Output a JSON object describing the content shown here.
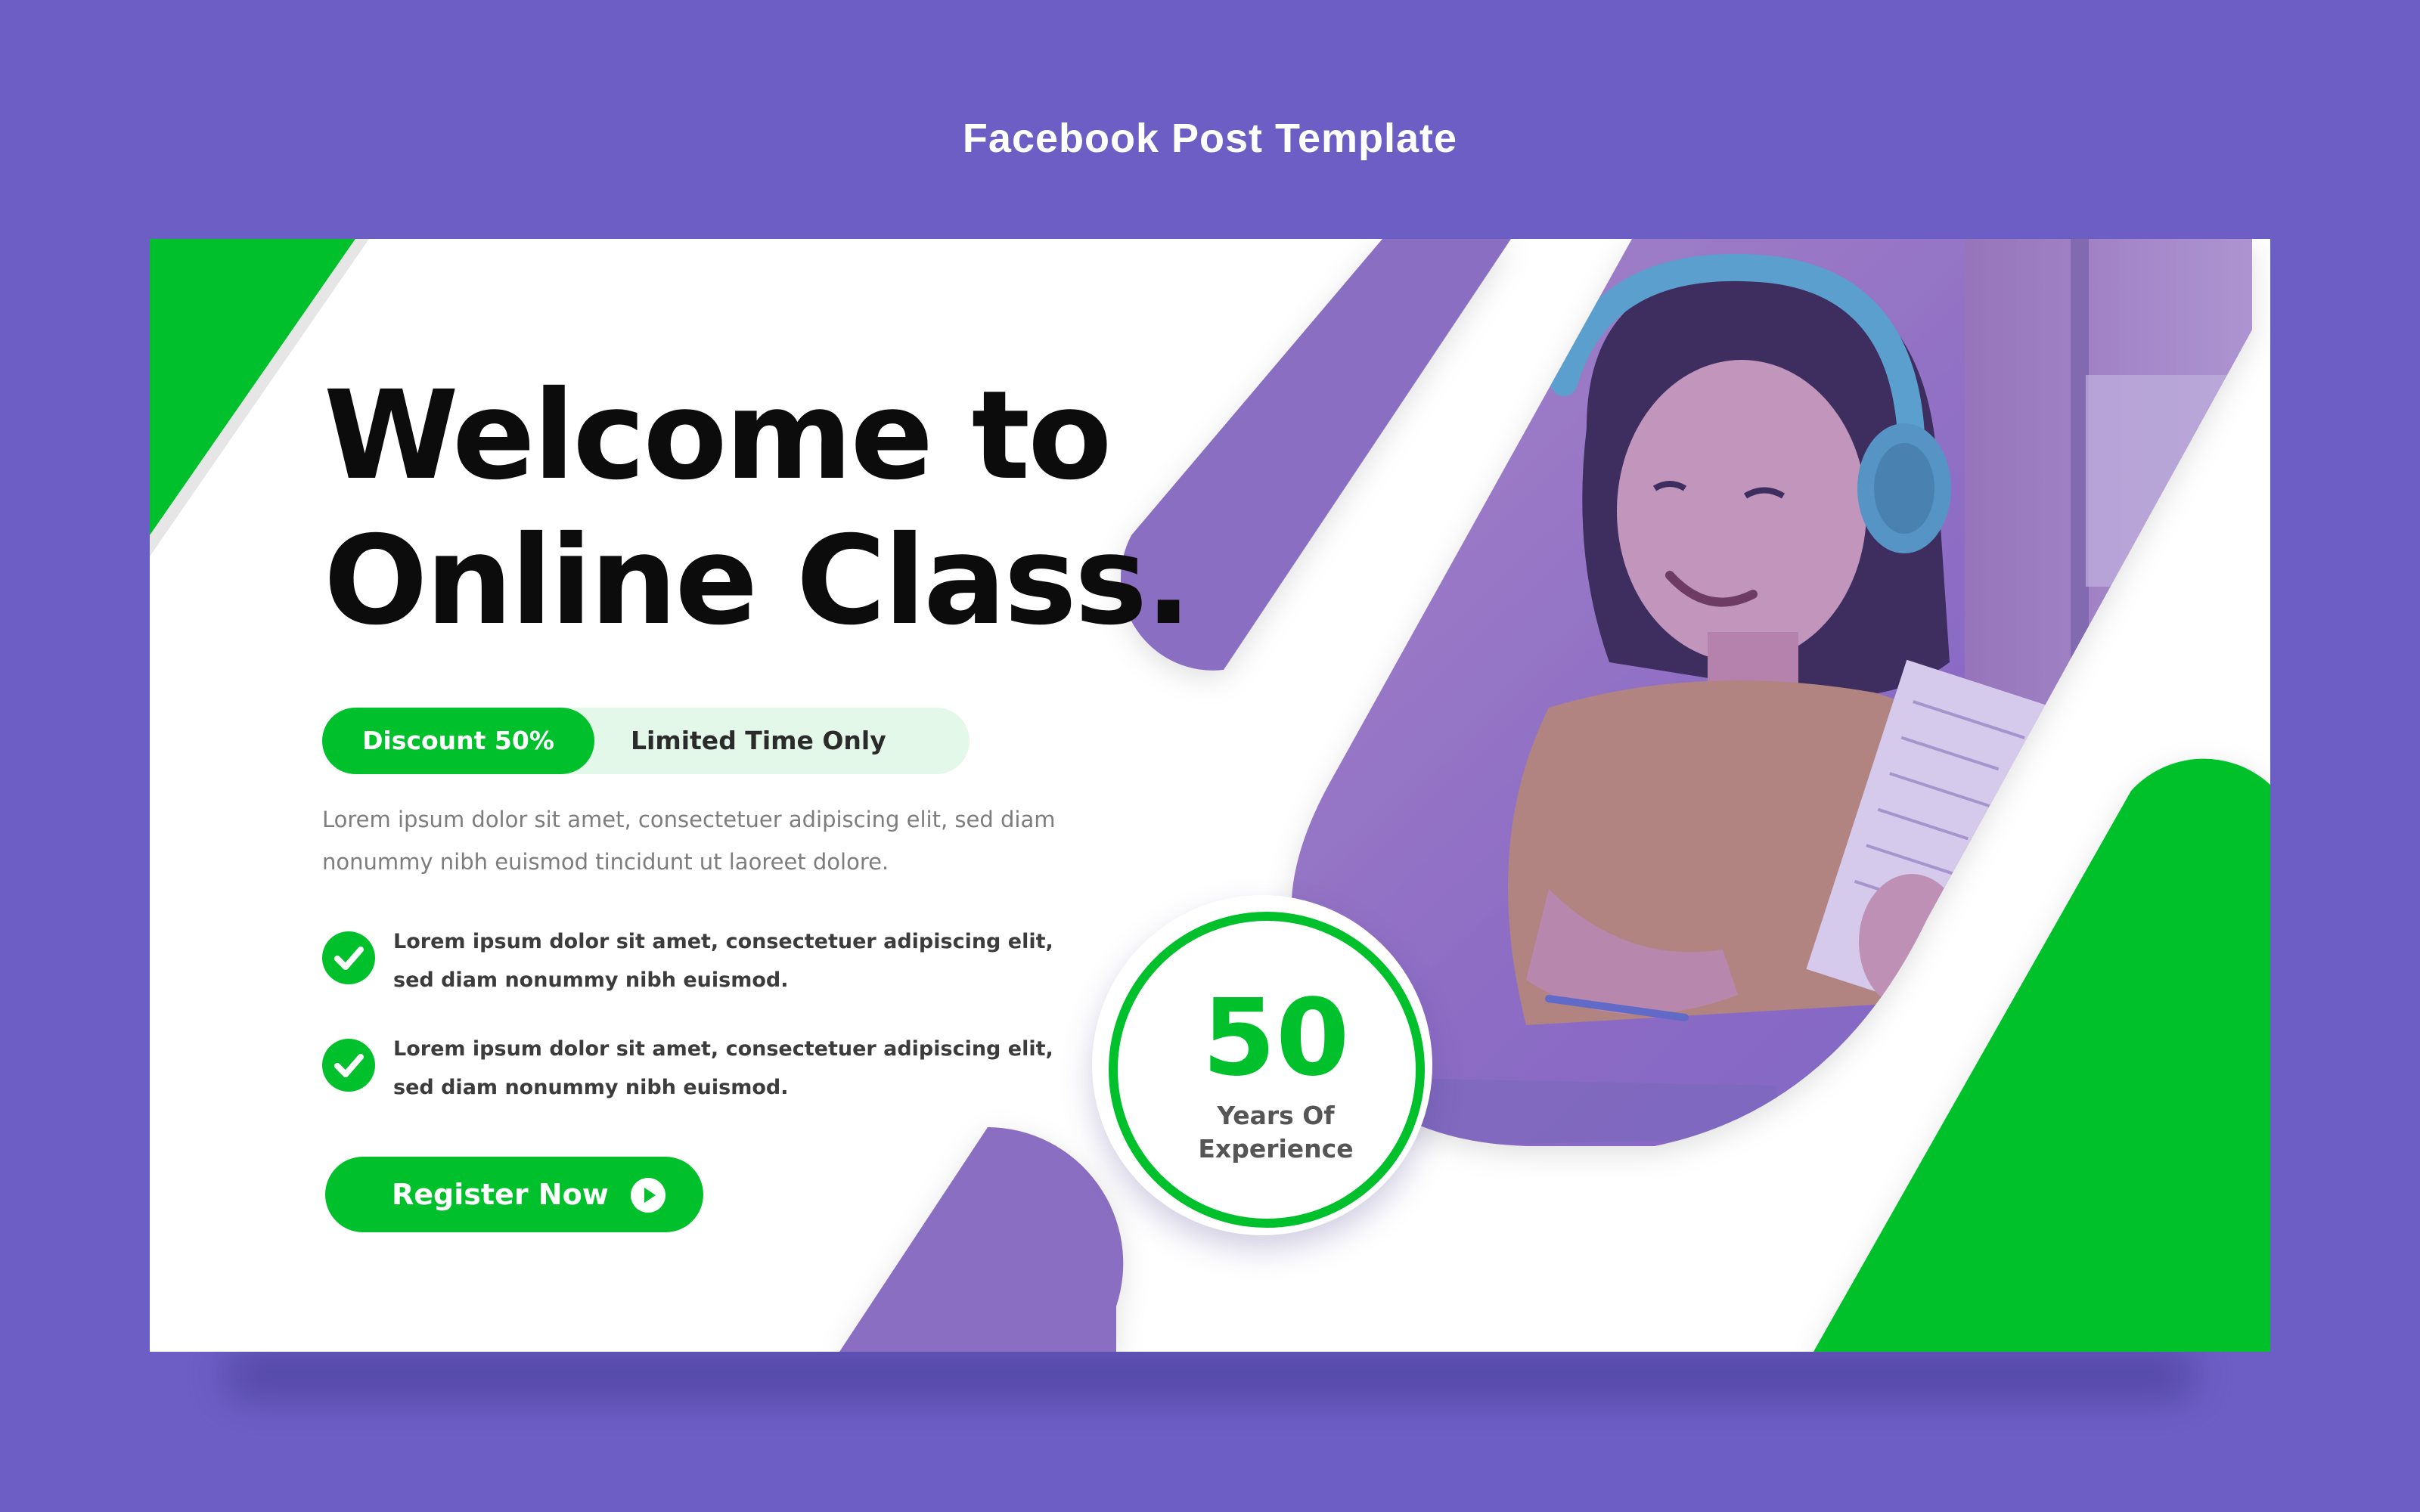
{
  "page": {
    "title": "Facebook Post Template"
  },
  "hero": {
    "line1": "Welcome to",
    "line2": "Online Class."
  },
  "promo": {
    "discount": "Discount 50%",
    "limited": "Limited Time Only"
  },
  "intro": "Lorem ipsum dolor sit amet, consectetuer adipiscing elit, sed diam nonummy nibh euismod tincidunt ut laoreet dolore.",
  "bullets": [
    {
      "text": "Lorem ipsum dolor sit amet, consectetuer adipiscing elit, sed diam nonummy nibh euismod."
    },
    {
      "text": "Lorem ipsum dolor sit amet, consectetuer adipiscing elit, sed diam nonummy nibh euismod."
    }
  ],
  "cta": {
    "label": "Register Now"
  },
  "badge": {
    "number": "50",
    "line1": "Years Of",
    "line2": "Experience"
  },
  "colors": {
    "background": "#6c5ec4",
    "green": "#00c12c",
    "purple": "#8a6ec2",
    "text_dark": "#0c0c0c",
    "pill_bg": "#e3f8e8"
  },
  "icons": {
    "check": "check-circle-icon",
    "play": "play-circle-icon"
  }
}
